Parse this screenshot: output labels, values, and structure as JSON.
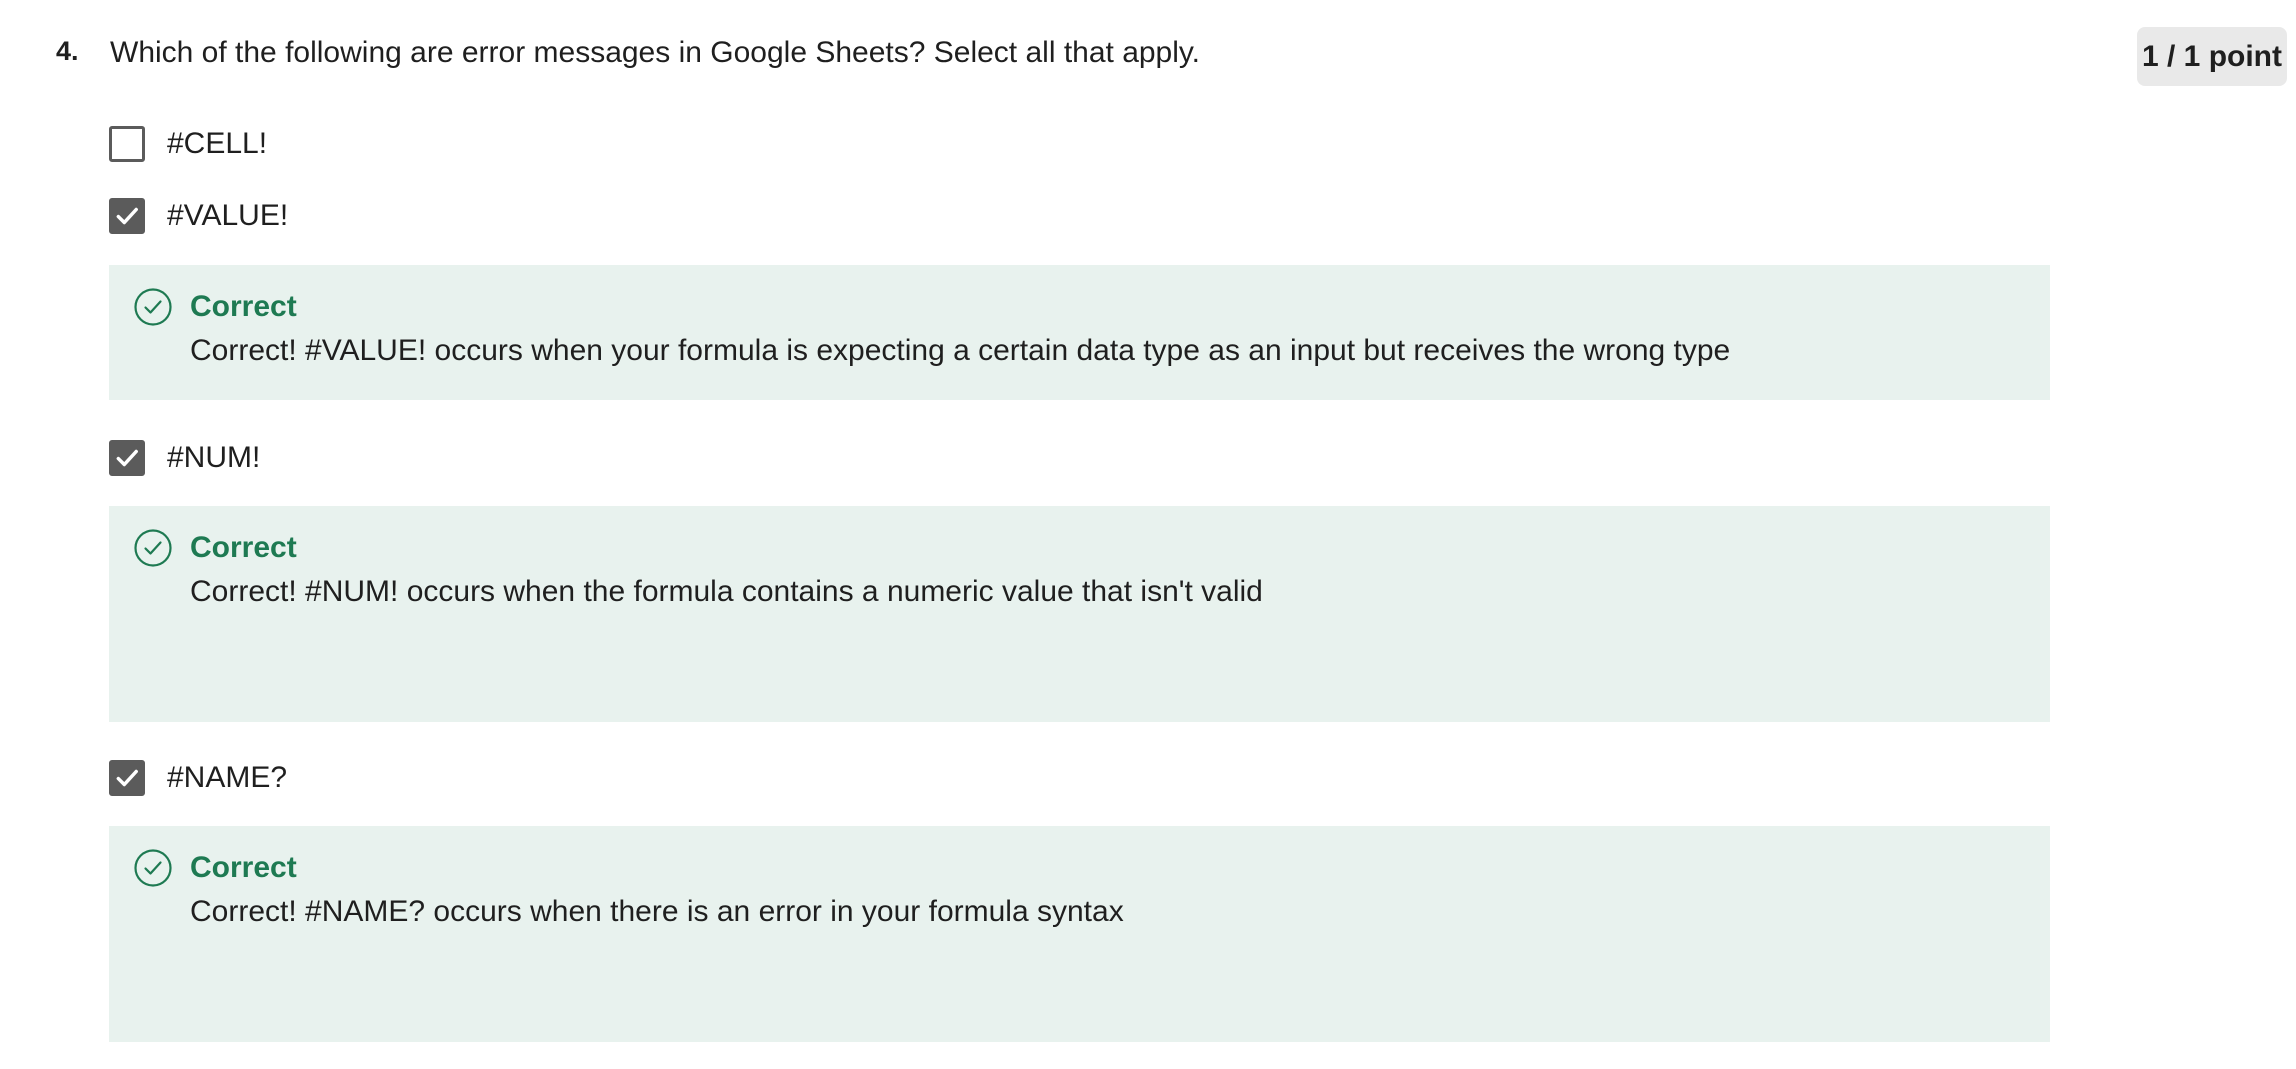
{
  "question": {
    "number": "4.",
    "text": "Which of the following are error messages in Google Sheets? Select all that apply.",
    "score": "1 / 1 point"
  },
  "options": [
    {
      "label": "#CELL!",
      "checked": false
    },
    {
      "label": "#VALUE!",
      "checked": true
    },
    {
      "label": "#NUM!",
      "checked": true
    },
    {
      "label": "#NAME?",
      "checked": true
    }
  ],
  "feedback": [
    {
      "title": "Correct",
      "text": "Correct! #VALUE! occurs when your formula is expecting a certain data type as an input but receives the wrong type"
    },
    {
      "title": "Correct",
      "text": "Correct! #NUM! occurs when the formula contains a numeric value that isn't valid"
    },
    {
      "title": "Correct",
      "text": "Correct! #NAME? occurs when there is an error in your formula syntax"
    }
  ],
  "icons": {
    "checkbox_check": "check-icon",
    "feedback_icon": "check-circle-icon"
  },
  "colors": {
    "correct_green": "#1e7a52",
    "feedback_bg": "#e8f2ee",
    "checkbox_fill": "#5b5b5b",
    "score_bg": "#e9e9e9"
  }
}
